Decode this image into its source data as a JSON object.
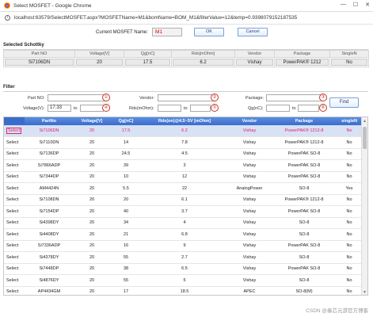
{
  "window": {
    "title": "Select MOSFET - Google Chrome",
    "minimize_glyph": "—",
    "maximize_glyph": "☐",
    "close_glyph": "✕"
  },
  "address": {
    "url": "localhost:63579/SelectMOSFET.aspx?MOSFETName=M1&bomName=BOM_M1&filterValue=12&temp=0.9398079152187535"
  },
  "current": {
    "label": "Current MOSFET Name:",
    "value": "M1",
    "ok_label": "OK",
    "cancel_label": "Cancel"
  },
  "schottky": {
    "title": "Selected Schottky",
    "headers": [
      "Part NO",
      "Voltage[V]",
      "Qg[nC]",
      "Rds[mOhm]",
      "Vendor",
      "Package",
      "SingleN"
    ],
    "values": [
      "Si7106DN",
      "20",
      "17.5",
      "6.2",
      "Vishay",
      "PowerPAK® 1212",
      "No"
    ]
  },
  "filter": {
    "title": "Filter",
    "part_no_label": "Part NO:",
    "vendor_label": "Vendor:",
    "package_label": "Package:",
    "voltage_label": "Voltage(V):",
    "voltage_from": "17.33",
    "to_label": "to",
    "rds_label": "Rds(mOhm):",
    "qg_label": "Qg(nC):",
    "find_label": "Find",
    "markers": [
      "①",
      "②",
      "③",
      "④",
      "⑤",
      "⑥"
    ]
  },
  "grid": {
    "headers": [
      "",
      "PartNo",
      "Voltage[V]",
      "Qg[nC]",
      "Rds(on)@4.5~5V [mOhm]",
      "Vendor",
      "Package",
      "singleN"
    ],
    "select_label": "Select",
    "rows": [
      [
        "Si7106DN",
        "20",
        "17.5",
        "6.2",
        "Vishay",
        "PowerPAK® 1212-8",
        "No"
      ],
      [
        "Si7110DN",
        "20",
        "14",
        "7.8",
        "Vishay",
        "PowerPAK® 1212-8",
        "No"
      ],
      [
        "Si7136DP",
        "20",
        "24.5",
        "4.5",
        "Vishay",
        "PowerPAK SO-8",
        "No"
      ],
      [
        "Si7866ADP",
        "20",
        "39",
        "3",
        "Vishay",
        "PowerPAK SO-8",
        "No"
      ],
      [
        "Si7344DP",
        "20",
        "10",
        "12",
        "Vishay",
        "PowerPAK SO-8",
        "No"
      ],
      [
        "AM4424N",
        "20",
        "5.5",
        "22",
        "AnalogPower",
        "SO-8",
        "Yes"
      ],
      [
        "Si7108DN",
        "20",
        "20",
        "6.1",
        "Vishay",
        "PowerPAK® 1212-8",
        "No"
      ],
      [
        "Si7154DP",
        "20",
        "40",
        "3.7",
        "Vishay",
        "PowerPAK SO-8",
        "No"
      ],
      [
        "Si4398DY",
        "20",
        "34",
        "4",
        "Vishay",
        "SO-8",
        "No"
      ],
      [
        "Si4408DY",
        "20",
        "21",
        "6.8",
        "Vishay",
        "SO-8",
        "No"
      ],
      [
        "Si7336ADP",
        "20",
        "16",
        "9",
        "Vishay",
        "PowerPAK SO-8",
        "No"
      ],
      [
        "Si4378DY",
        "20",
        "55",
        "2.7",
        "Vishay",
        "SO-8",
        "No"
      ],
      [
        "Si7448DP",
        "20",
        "38",
        "6.5",
        "Vishay",
        "PowerPAK SO-8",
        "No"
      ],
      [
        "Si4876DY",
        "20",
        "55",
        "5",
        "Vishay",
        "SO-8",
        "No"
      ],
      [
        "AP4434GM",
        "20",
        "17",
        "18.5",
        "APEC",
        "SO-8(M)",
        "No"
      ],
      [
        "AP4436GM",
        "20",
        "10",
        "32",
        "APEC",
        "SO-8(M)",
        "No"
      ]
    ]
  },
  "watermark": "CSDN @秦芯元游官方博客",
  "colors": {
    "accent_red": "#e00000",
    "grid_header": "#3a6ccc",
    "selected_row_text": "#e0226f",
    "marker_red": "#c0392b"
  }
}
